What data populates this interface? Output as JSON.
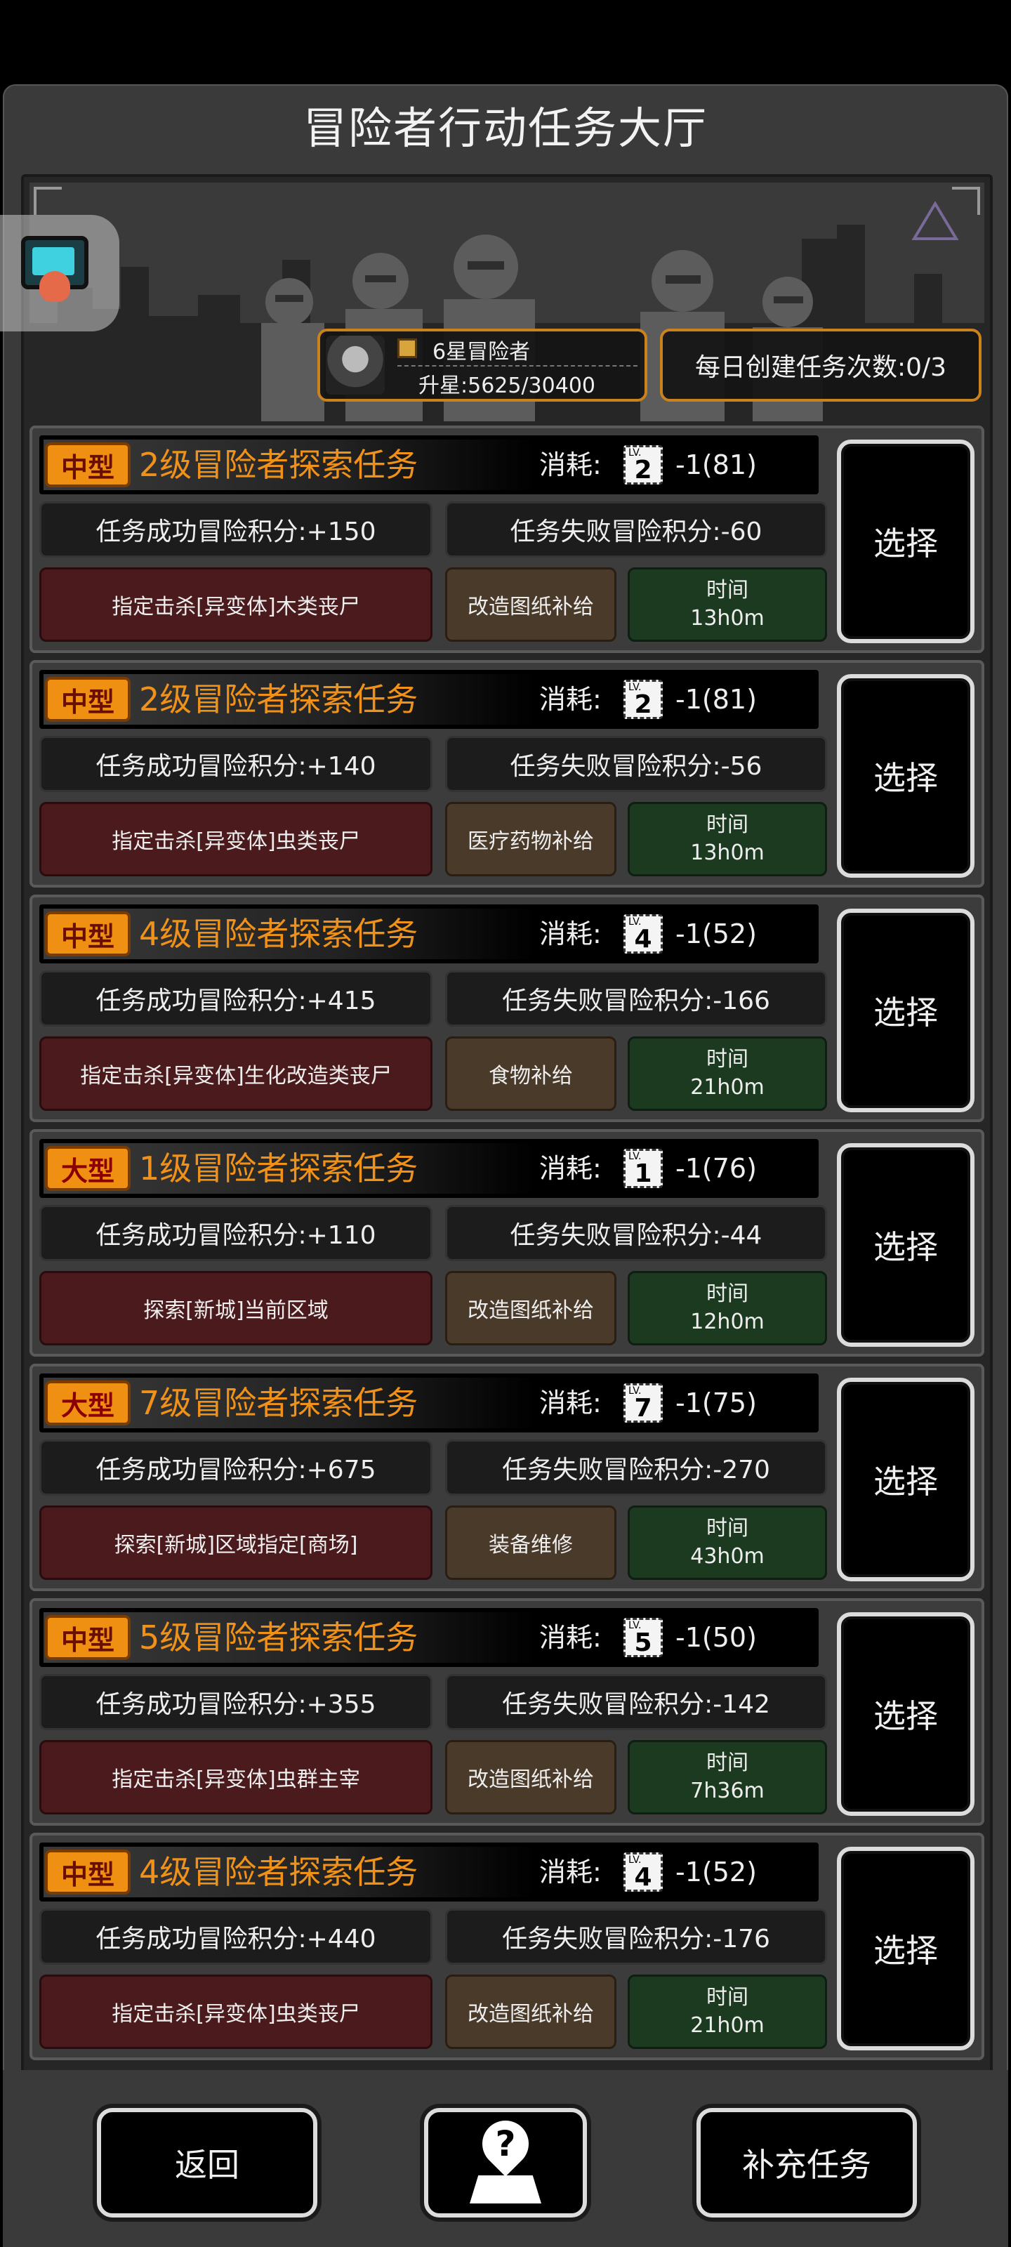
{
  "header": {
    "title": "冒险者行动任务大厅"
  },
  "rank": {
    "title": "6星冒险者",
    "progress": "升星:5625/30400"
  },
  "daily": {
    "label": "每日创建任务次数:0/3"
  },
  "missions": [
    {
      "size": "中型",
      "name": "2级冒险者探索任务",
      "cost_label": "消耗:",
      "cost_level": "2",
      "cost_value": "-1(81)",
      "success": "任务成功冒险积分:+150",
      "fail": "任务失败冒险积分:-60",
      "target": "指定击杀[异变体]木类丧尸",
      "reward": "改造图纸补给",
      "time_label": "时间",
      "time": "13h0m",
      "select": "选择"
    },
    {
      "size": "中型",
      "name": "2级冒险者探索任务",
      "cost_label": "消耗:",
      "cost_level": "2",
      "cost_value": "-1(81)",
      "success": "任务成功冒险积分:+140",
      "fail": "任务失败冒险积分:-56",
      "target": "指定击杀[异变体]虫类丧尸",
      "reward": "医疗药物补给",
      "time_label": "时间",
      "time": "13h0m",
      "select": "选择"
    },
    {
      "size": "中型",
      "name": "4级冒险者探索任务",
      "cost_label": "消耗:",
      "cost_level": "4",
      "cost_value": "-1(52)",
      "success": "任务成功冒险积分:+415",
      "fail": "任务失败冒险积分:-166",
      "target": "指定击杀[异变体]生化改造类丧尸",
      "reward": "食物补给",
      "time_label": "时间",
      "time": "21h0m",
      "select": "选择"
    },
    {
      "size": "大型",
      "name": "1级冒险者探索任务",
      "cost_label": "消耗:",
      "cost_level": "1",
      "cost_value": "-1(76)",
      "success": "任务成功冒险积分:+110",
      "fail": "任务失败冒险积分:-44",
      "target": "探索[新城]当前区域",
      "reward": "改造图纸补给",
      "time_label": "时间",
      "time": "12h0m",
      "select": "选择"
    },
    {
      "size": "大型",
      "name": "7级冒险者探索任务",
      "cost_label": "消耗:",
      "cost_level": "7",
      "cost_value": "-1(75)",
      "success": "任务成功冒险积分:+675",
      "fail": "任务失败冒险积分:-270",
      "target": "探索[新城]区域指定[商场]",
      "reward": "装备维修",
      "time_label": "时间",
      "time": "43h0m",
      "select": "选择"
    },
    {
      "size": "中型",
      "name": "5级冒险者探索任务",
      "cost_label": "消耗:",
      "cost_level": "5",
      "cost_value": "-1(50)",
      "success": "任务成功冒险积分:+355",
      "fail": "任务失败冒险积分:-142",
      "target": "指定击杀[异变体]虫群主宰",
      "reward": "改造图纸补给",
      "time_label": "时间",
      "time": "7h36m",
      "select": "选择"
    },
    {
      "size": "中型",
      "name": "4级冒险者探索任务",
      "cost_label": "消耗:",
      "cost_level": "4",
      "cost_value": "-1(52)",
      "success": "任务成功冒险积分:+440",
      "fail": "任务失败冒险积分:-176",
      "target": "指定击杀[异变体]虫类丧尸",
      "reward": "改造图纸补给",
      "time_label": "时间",
      "time": "21h0m",
      "select": "选择"
    }
  ],
  "footer": {
    "back": "返回",
    "help_icon": "help-map-pin-icon",
    "refill": "补充任务"
  },
  "colors": {
    "accent_orange": "#f0921a",
    "badge_orange": "#f09012",
    "target_red": "#4a1a1c",
    "reward_brown": "#4a3a2a",
    "time_green": "#1c3a20"
  }
}
